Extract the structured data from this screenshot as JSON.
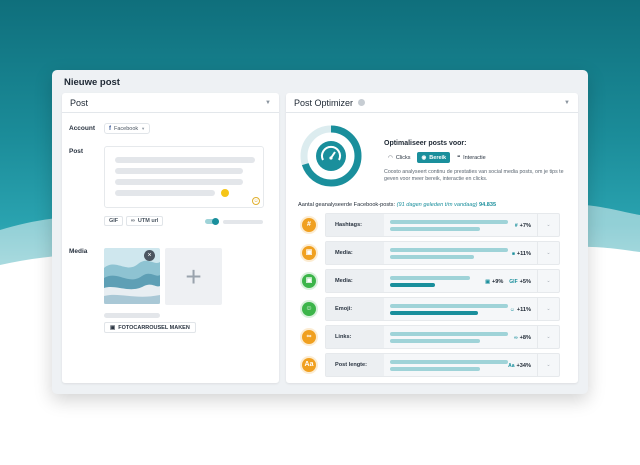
{
  "window": {
    "title": "Nieuwe post"
  },
  "post_panel": {
    "title": "Post",
    "account_label": "Account",
    "account_value": "Facebook",
    "post_label": "Post",
    "gif_label": "GIF",
    "utm_label": "UTM url",
    "media_label": "Media",
    "carousel_label": "FOTOCARROUSEL MAKEN"
  },
  "optimizer": {
    "title": "Post Optimizer",
    "optimize_title": "Optimaliseer posts voor:",
    "modes": [
      "Clicks",
      "Bereik",
      "Interactie"
    ],
    "active_mode": "Bereik",
    "description": "Coosto analyseert continu de prestaties van social media posts, om je tips te geven voor meer bereik, interactie en clicks.",
    "analyzed_label": "Aantal geanalyseerde Facebook-posts:",
    "analyzed_period": "(91 dagen geleden t/m vandaag)",
    "analyzed_count": "94.835",
    "gauge_level": 0.7,
    "metrics": [
      {
        "name": "Hashtags:",
        "icon": "#",
        "color": "#f0a020",
        "deltas": [
          {
            "icon": "#",
            "value": "+7%"
          }
        ]
      },
      {
        "name": "Media:",
        "icon": "▣",
        "color": "#f0a020",
        "deltas": [
          {
            "icon": "■",
            "value": "+11%"
          }
        ]
      },
      {
        "name": "Media:",
        "icon": "▣",
        "color": "#3cb54a",
        "deltas": [
          {
            "icon": "▣",
            "value": "+9%"
          },
          {
            "icon": "GIF",
            "value": "+5%"
          }
        ]
      },
      {
        "name": "Emoji:",
        "icon": "☺",
        "color": "#3cb54a",
        "deltas": [
          {
            "icon": "☺",
            "value": "+11%"
          }
        ]
      },
      {
        "name": "Links:",
        "icon": "∞",
        "color": "#f0a020",
        "deltas": [
          {
            "icon": "∞",
            "value": "+8%"
          }
        ]
      },
      {
        "name": "Post lengte:",
        "icon": "Aa",
        "color": "#f0a020",
        "deltas": [
          {
            "icon": "Aa",
            "value": "+34%"
          }
        ]
      }
    ]
  }
}
